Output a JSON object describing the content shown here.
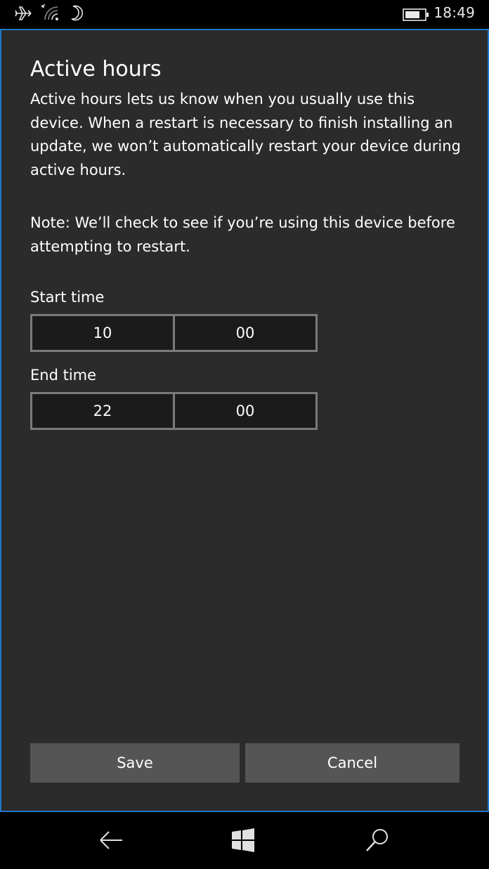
{
  "status_bar": {
    "time": "18:49",
    "icons": [
      "airplane-icon",
      "wifi-icon",
      "moon-icon",
      "battery-icon"
    ]
  },
  "dialog": {
    "title": "Active hours",
    "description": "Active hours lets us know when you usually use this device. When a restart is necessary to finish installing an update, we won’t automatically restart your device during active hours.",
    "note": "Note: We’ll check to see if you’re using this device before attempting to restart.",
    "start_time": {
      "label": "Start time",
      "hour": "10",
      "minute": "00"
    },
    "end_time": {
      "label": "End time",
      "hour": "22",
      "minute": "00"
    },
    "save_label": "Save",
    "cancel_label": "Cancel",
    "accent_color": "#1f78c8"
  },
  "nav_bar": {
    "icons": [
      "back-arrow-icon",
      "windows-start-icon",
      "search-icon"
    ]
  }
}
